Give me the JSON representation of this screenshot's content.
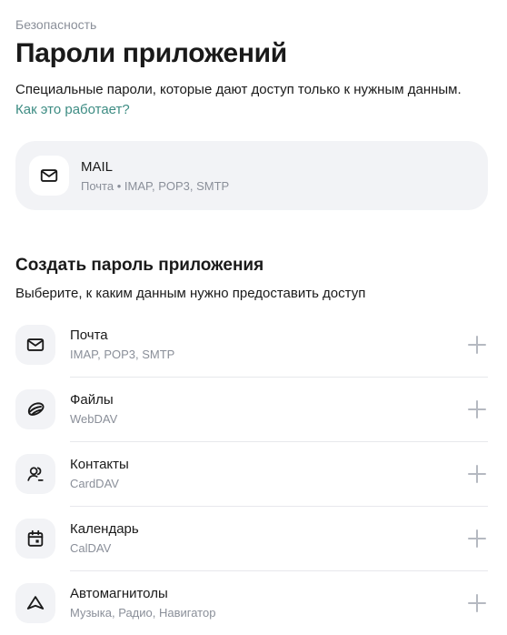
{
  "breadcrumb": "Безопасность",
  "title": "Пароли приложений",
  "description": {
    "text": "Специальные пароли, которые дают доступ только к нужным данным.",
    "link": "Как это работает?"
  },
  "existing_password": {
    "icon": "mail-icon",
    "name": "MAIL",
    "scopes": "Почта • IMAP, POP3, SMTP"
  },
  "create_section": {
    "title": "Создать пароль приложения",
    "subtitle": "Выберите, к каким данным нужно предоставить доступ",
    "items": [
      {
        "icon": "mail-icon",
        "label": "Почта",
        "sub": "IMAP, POP3, SMTP"
      },
      {
        "icon": "files-icon",
        "label": "Файлы",
        "sub": "WebDAV"
      },
      {
        "icon": "contacts-icon",
        "label": "Контакты",
        "sub": "CardDAV"
      },
      {
        "icon": "calendar-icon",
        "label": "Календарь",
        "sub": "CalDAV"
      },
      {
        "icon": "car-radio-icon",
        "label": "Автомагнитолы",
        "sub": "Музыка, Радио, Навигатор"
      }
    ]
  },
  "colors": {
    "link": "#3d8c83",
    "card_bg": "#f2f3f6",
    "muted_text": "#8a8f99",
    "plus": "#b5b9c1"
  }
}
